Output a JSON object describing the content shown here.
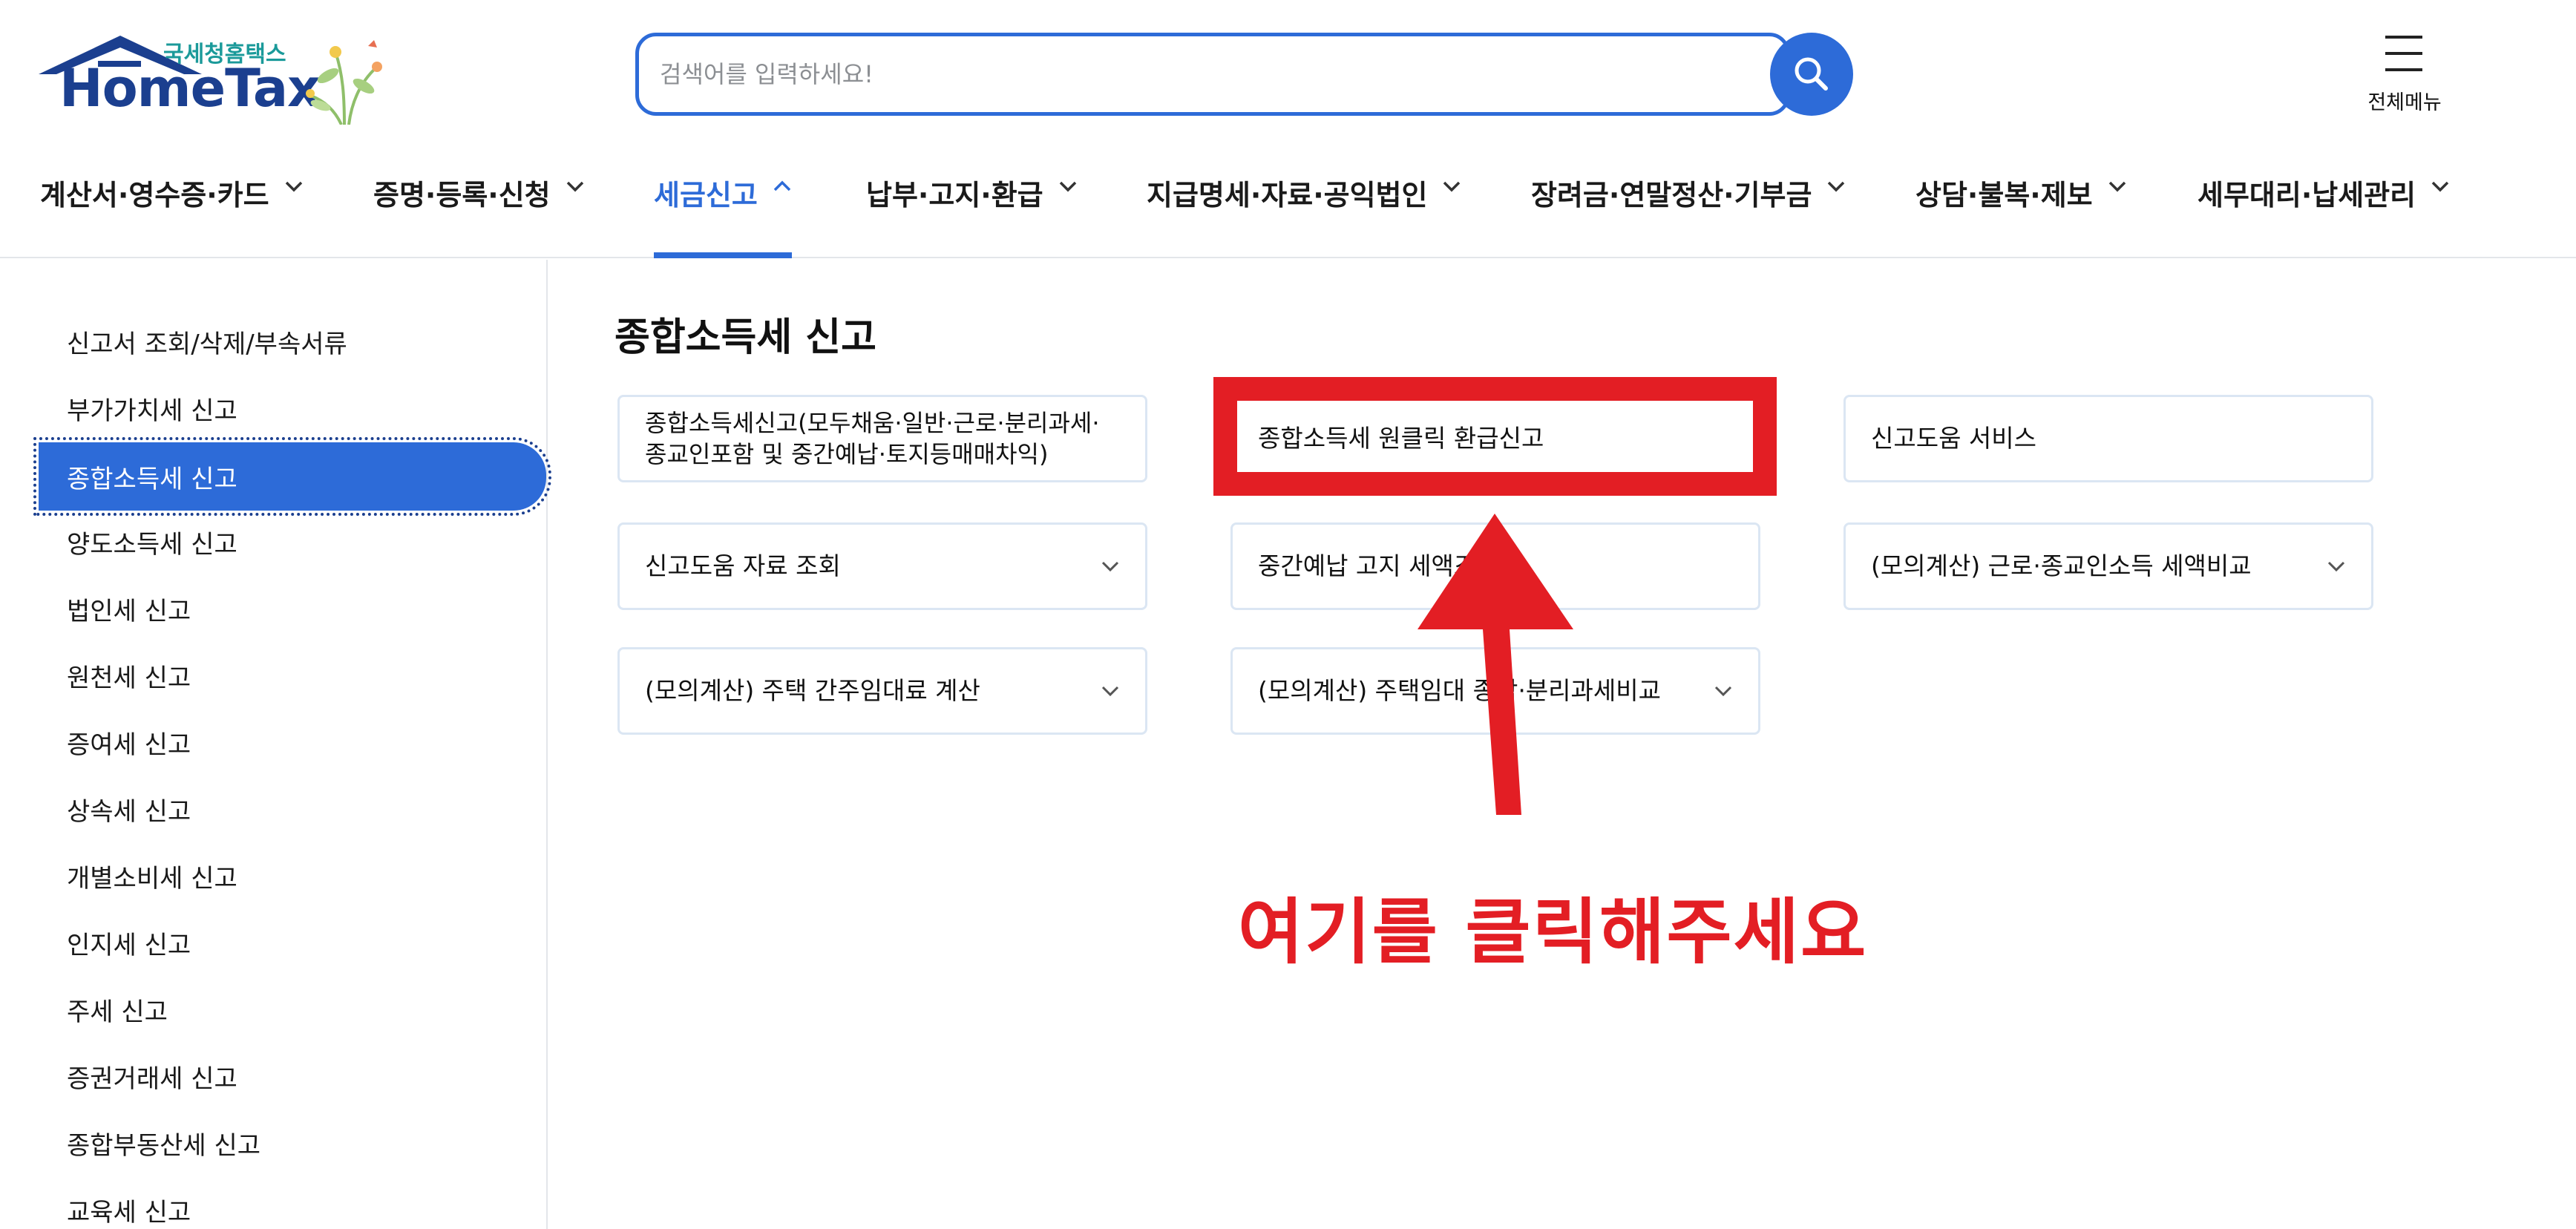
{
  "brand": {
    "sub": "국세청홈택스",
    "name": "HomeTax"
  },
  "search": {
    "placeholder": "검색어를 입력하세요!",
    "value": ""
  },
  "header": {
    "allmenu_label": "전체메뉴"
  },
  "gnb": {
    "items": [
      {
        "label": "계산서·영수증·카드",
        "active": false
      },
      {
        "label": "증명·등록·신청",
        "active": false
      },
      {
        "label": "세금신고",
        "active": true
      },
      {
        "label": "납부·고지·환급",
        "active": false
      },
      {
        "label": "지급명세·자료·공익법인",
        "active": false
      },
      {
        "label": "장려금·연말정산·기부금",
        "active": false
      },
      {
        "label": "상담·불복·제보",
        "active": false
      },
      {
        "label": "세무대리·납세관리",
        "active": false
      }
    ]
  },
  "sidebar": {
    "items": [
      {
        "label": "신고서 조회/삭제/부속서류",
        "active": false
      },
      {
        "label": "부가가치세 신고",
        "active": false
      },
      {
        "label": "종합소득세 신고",
        "active": true
      },
      {
        "label": "양도소득세 신고",
        "active": false
      },
      {
        "label": "법인세 신고",
        "active": false
      },
      {
        "label": "원천세 신고",
        "active": false
      },
      {
        "label": "증여세 신고",
        "active": false
      },
      {
        "label": "상속세 신고",
        "active": false
      },
      {
        "label": "개별소비세 신고",
        "active": false
      },
      {
        "label": "인지세 신고",
        "active": false
      },
      {
        "label": "주세 신고",
        "active": false
      },
      {
        "label": "증권거래세 신고",
        "active": false
      },
      {
        "label": "종합부동산세 신고",
        "active": false
      },
      {
        "label": "교육세 신고",
        "active": false
      }
    ]
  },
  "main": {
    "title": "종합소득세 신고",
    "cards": [
      {
        "label": "종합소득세신고(모두채움·일반·근로·분리과세·종교인포함 및 중간예납·토지등매매차익)",
        "has_dropdown": false,
        "highlighted": false
      },
      {
        "label": "종합소득세 원클릭 환급신고",
        "has_dropdown": false,
        "highlighted": true
      },
      {
        "label": "신고도움 서비스",
        "has_dropdown": false,
        "highlighted": false
      },
      {
        "label": "신고도움 자료 조회",
        "has_dropdown": true,
        "highlighted": false
      },
      {
        "label": "중간예납 고지 세액조회",
        "has_dropdown": false,
        "highlighted": false
      },
      {
        "label": "(모의계산) 근로·종교인소득 세액비교",
        "has_dropdown": true,
        "highlighted": false
      },
      {
        "label": "(모의계산) 주택 간주임대료 계산",
        "has_dropdown": true,
        "highlighted": false
      },
      {
        "label": "(모의계산) 주택임대 종합·분리과세비교",
        "has_dropdown": true,
        "highlighted": false
      }
    ]
  },
  "annotation": {
    "text": "여기를 클릭해주세요"
  },
  "colors": {
    "accent": "#2d6bd8",
    "brand_navy": "#1b3f8f",
    "brand_teal": "#1b9a9a",
    "annotation_red": "#e31e24",
    "card_border": "#dbe6f3"
  },
  "icons": {
    "search": "search-icon",
    "menu": "hamburger-menu-icon",
    "chevron_down": "chevron-down-icon",
    "chevron_up": "chevron-up-icon"
  }
}
